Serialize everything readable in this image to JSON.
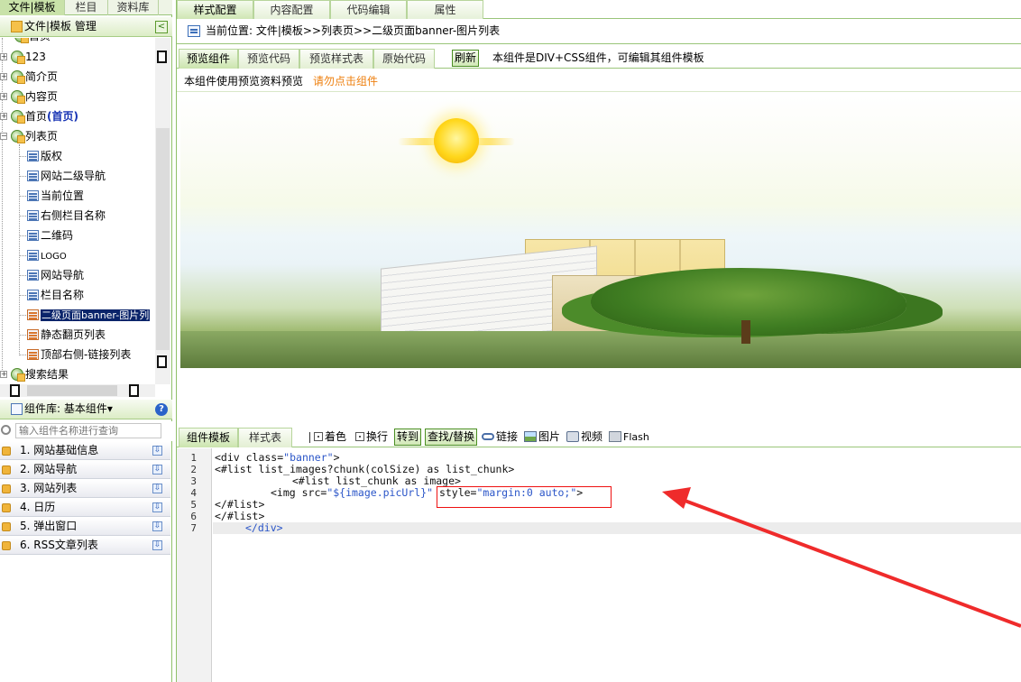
{
  "left": {
    "top_tabs": [
      "文件|模板",
      "栏目",
      "资料库"
    ],
    "panel_title": "文件|模板 管理",
    "collapse_symbol": "<",
    "tree": {
      "partial_top": "首页",
      "items": [
        {
          "label": "123",
          "type": "group"
        },
        {
          "label": "简介页",
          "type": "group"
        },
        {
          "label": "内容页",
          "type": "group"
        },
        {
          "label": "首页",
          "suffix": "(首页)",
          "type": "group"
        },
        {
          "label": "列表页",
          "type": "group",
          "expanded": true
        },
        {
          "label": "版权",
          "type": "page"
        },
        {
          "label": "网站二级导航",
          "type": "page"
        },
        {
          "label": "当前位置",
          "type": "page"
        },
        {
          "label": "右侧栏目名称",
          "type": "page"
        },
        {
          "label": "二维码",
          "type": "page"
        },
        {
          "label": "LOGO",
          "type": "page"
        },
        {
          "label": "网站导航",
          "type": "page"
        },
        {
          "label": "栏目名称",
          "type": "page"
        },
        {
          "label": "二级页面banner-图片列",
          "type": "page",
          "selected": true
        },
        {
          "label": "静态翻页列表",
          "type": "page"
        },
        {
          "label": "顶部右侧-链接列表",
          "type": "page"
        },
        {
          "label": "搜索结果",
          "type": "group"
        }
      ]
    },
    "library": {
      "title": "组件库: 基本组件▾",
      "help_symbol": "?",
      "search_placeholder": "输入组件名称进行查询",
      "items": [
        "1. 网站基础信息",
        "2. 网站导航",
        "3. 网站列表",
        "4. 日历",
        "5. 弹出窗口",
        "6. RSS文章列表"
      ]
    }
  },
  "right": {
    "main_tabs": [
      "样式配置",
      "内容配置",
      "代码编辑",
      "属性"
    ],
    "location": "当前位置: 文件|模板>>列表页>>二级页面banner-图片列表",
    "sub_tabs": [
      "预览组件",
      "预览代码",
      "预览样式表",
      "原始代码"
    ],
    "refresh": "刷新",
    "sub_note": "本组件是DIV+CSS组件，可编辑其组件模板",
    "preview_note": "本组件使用预览资料预览",
    "preview_warning": "请勿点击组件",
    "editor_tabs": [
      "组件模板",
      "样式表"
    ],
    "tools": {
      "color": "着色",
      "wrap": "换行",
      "goto": "转到",
      "find": "查找/替换",
      "link": "链接",
      "image": "图片",
      "video": "视频",
      "flash": "Flash"
    },
    "code": {
      "line_numbers": [
        "1",
        "2",
        "3",
        "4",
        "5",
        "6",
        "7"
      ],
      "l1a": "<div class=",
      "l1s": "\"banner\"",
      "l1b": ">",
      "l2": "<#list list_images?chunk(colSize) as list_chunk>",
      "l3": "<#list list_chunk as image>",
      "l4a": "<img src=",
      "l4s": "\"${image.picUrl}\"",
      "l4b": " style=",
      "l4c": "\"margin:0 auto;\"",
      "l4d": ">",
      "l5": "</#list>",
      "l6": "</#list>",
      "l7": "</div>"
    },
    "colors": {
      "accent_green": "#9ac57a",
      "highlight": "#e11111",
      "warning": "#ee7f0e"
    }
  }
}
